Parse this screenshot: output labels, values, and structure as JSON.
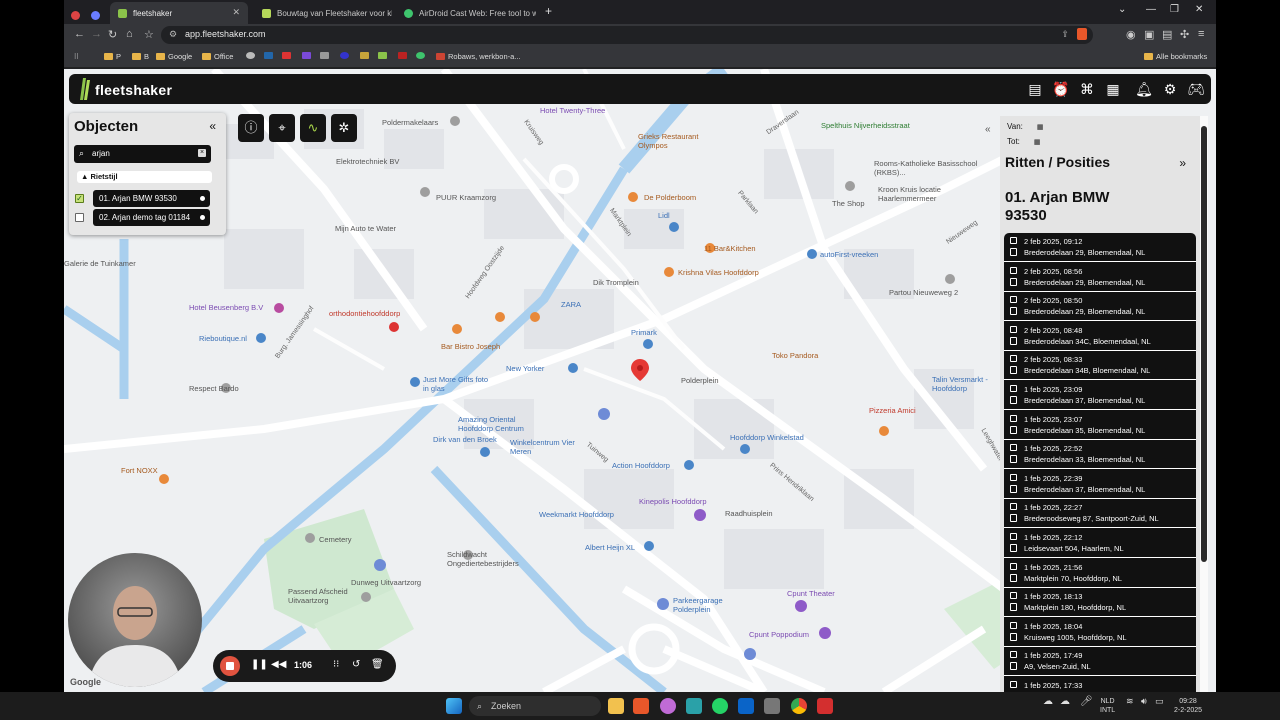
{
  "browser": {
    "tabs": [
      {
        "title": "fleetshaker",
        "active": true
      },
      {
        "title": "Bouwtag van Fleetshaker voor klein",
        "active": false
      },
      {
        "title": "AirDroid Cast Web: Free tool to wir",
        "active": false
      }
    ],
    "new_tab": "+",
    "url": "app.fleetshaker.com",
    "bookmarks": [
      "P",
      "B",
      "Google",
      "Office",
      "Robaws, werkbon-a..."
    ],
    "all_bookmarks": "Alle bookmarks"
  },
  "app": {
    "logo": "fleetshaker",
    "header_icons": [
      "panel-icon",
      "alarm-icon",
      "route-icon",
      "document-icon",
      "bell-icon",
      "gear-icon",
      "gamepad-icon"
    ]
  },
  "objects_panel": {
    "title": "Objecten",
    "collapse": "«",
    "search_value": "arjan",
    "group": "▲ Rietstijl",
    "items": [
      {
        "label": "01. Arjan BMW 93530",
        "checked": true
      },
      {
        "label": "02. Arjan demo tag 01184",
        "checked": false
      }
    ]
  },
  "ritten_panel": {
    "van_label": "Van:",
    "tot_label": "Tot:",
    "title": "Ritten / Posities",
    "expand": "»",
    "collapse": "«",
    "vehicle": "01. Arjan BMW 93530",
    "entries": [
      {
        "time": "2 feb 2025, 09:12",
        "address": "Brederodelaan 29, Bloemendaal, NL"
      },
      {
        "time": "2 feb 2025, 08:56",
        "address": "Brederodelaan 29, Bloemendaal, NL"
      },
      {
        "time": "2 feb 2025, 08:50",
        "address": "Brederodelaan 29, Bloemendaal, NL"
      },
      {
        "time": "2 feb 2025, 08:48",
        "address": "Brederodelaan 34C, Bloemendaal, NL"
      },
      {
        "time": "2 feb 2025, 08:33",
        "address": "Brederodelaan 34B, Bloemendaal, NL"
      },
      {
        "time": "1 feb 2025, 23:09",
        "address": "Brederodelaan 37, Bloemendaal, NL"
      },
      {
        "time": "1 feb 2025, 23:07",
        "address": "Brederodelaan 35, Bloemendaal, NL"
      },
      {
        "time": "1 feb 2025, 22:52",
        "address": "Brederodelaan 33, Bloemendaal, NL"
      },
      {
        "time": "1 feb 2025, 22:39",
        "address": "Brederodelaan 37, Bloemendaal, NL"
      },
      {
        "time": "1 feb 2025, 22:27",
        "address": "Brederoodseweg 87, Santpoort-Zuid, NL"
      },
      {
        "time": "1 feb 2025, 22:12",
        "address": "Leidsevaart 504, Haarlem, NL"
      },
      {
        "time": "1 feb 2025, 21:56",
        "address": "Marktplein 70, Hoofddorp, NL"
      },
      {
        "time": "1 feb 2025, 18:13",
        "address": "Marktplein 180, Hoofddorp, NL"
      },
      {
        "time": "1 feb 2025, 18:04",
        "address": "Kruisweg 1005, Hoofddorp, NL"
      },
      {
        "time": "1 feb 2025, 17:49",
        "address": "A9, Velsen-Zuid, NL"
      },
      {
        "time": "1 feb 2025, 17:33",
        "address": ""
      }
    ]
  },
  "map": {
    "places": [
      {
        "name": "Hotel Twenty-Three",
        "kind": "purple"
      },
      {
        "name": "Poldermakelaars",
        "kind": "grey"
      },
      {
        "name": "Grieks Restaurant Olympos",
        "kind": "brown"
      },
      {
        "name": "Spelthuis Nijverheidsstraat",
        "kind": "green"
      },
      {
        "name": "Rooms-Katholieke Basisschool (RKBS)...",
        "kind": "grey"
      },
      {
        "name": "Kroon Kruis locatie Haarlemmermeer",
        "kind": "grey"
      },
      {
        "name": "Elektrotechniek BV",
        "kind": "grey"
      },
      {
        "name": "PUUR Kraamzorg",
        "kind": "grey"
      },
      {
        "name": "De Polderboom",
        "kind": "brown"
      },
      {
        "name": "Lidl",
        "kind": "blue"
      },
      {
        "name": "The Shop",
        "kind": "grey"
      },
      {
        "name": "Mijn Auto te Water",
        "kind": "grey"
      },
      {
        "name": "11 Bar&Kitchen",
        "kind": "brown"
      },
      {
        "name": "autoFirst-vreeken",
        "kind": "blue"
      },
      {
        "name": "Galerie de Tuinkamer",
        "kind": "grey"
      },
      {
        "name": "Dik Tromplein",
        "kind": "grey"
      },
      {
        "name": "Krishna Vilas Hoofddorp",
        "kind": "brown"
      },
      {
        "name": "Partou Nieuweweg 2",
        "kind": "grey"
      },
      {
        "name": "ZARA",
        "kind": "blue"
      },
      {
        "name": "Hotel Beusenberg B.V",
        "kind": "purple"
      },
      {
        "name": "orthodontiehoofddorp",
        "kind": "red"
      },
      {
        "name": "Primark",
        "kind": "blue"
      },
      {
        "name": "Rieboutique.nl",
        "kind": "blue"
      },
      {
        "name": "Bar Bistro Joseph",
        "kind": "brown"
      },
      {
        "name": "Toko Pandora",
        "kind": "brown"
      },
      {
        "name": "New Yorker",
        "kind": "blue"
      },
      {
        "name": "Polderplein",
        "kind": "grey"
      },
      {
        "name": "Just More Gifts foto in glas",
        "kind": "blue"
      },
      {
        "name": "Talin Versmarkt - Hoofddorp",
        "kind": "blue"
      },
      {
        "name": "Respect Bardo",
        "kind": "grey"
      },
      {
        "name": "Pizzeria Amici",
        "kind": "red"
      },
      {
        "name": "Amazing Oriental Hoofddorp Centrum",
        "kind": "blue"
      },
      {
        "name": "Dirk van den Broek",
        "kind": "blue"
      },
      {
        "name": "Winkelcentrum Vier Meren",
        "kind": "blue"
      },
      {
        "name": "Hoofddorp Winkelstad",
        "kind": "blue"
      },
      {
        "name": "Action Hoofddorp",
        "kind": "blue"
      },
      {
        "name": "Fort NOXX",
        "kind": "brown"
      },
      {
        "name": "Kinepolis Hoofddorp",
        "kind": "purple"
      },
      {
        "name": "Raadhuisplein",
        "kind": "grey"
      },
      {
        "name": "Weekmarkt Hoofddorp",
        "kind": "blue"
      },
      {
        "name": "Cemetery",
        "kind": "grey"
      },
      {
        "name": "Schildwacht Ongediertebestrijders",
        "kind": "grey"
      },
      {
        "name": "Albert Heijn XL",
        "kind": "blue"
      },
      {
        "name": "Dunweg Uitvaartzorg",
        "kind": "grey"
      },
      {
        "name": "Passend Afscheid Uitvaartzorg",
        "kind": "grey"
      },
      {
        "name": "Cpunt Theater",
        "kind": "purple"
      },
      {
        "name": "Parkeergarage Polderplein",
        "kind": "blue"
      },
      {
        "name": "Cpunt Poppodium",
        "kind": "purple"
      }
    ],
    "streets": [
      "Kruisweg",
      "Marktplein",
      "Parklaan",
      "Hoofdweg Oostzijde",
      "Burg. Jamessinghof",
      "Tuinweg",
      "Prins Hendriklaan",
      "Draverslaan",
      "Nieuweweg",
      "Leeghwaterstraat"
    ],
    "attribution": "Google"
  },
  "recorder": {
    "time": "1:06"
  },
  "taskbar": {
    "search": "Zoeken",
    "lang_1": "NLD",
    "lang_2": "INTL",
    "time": "09:28",
    "date": "2-2-2025"
  }
}
